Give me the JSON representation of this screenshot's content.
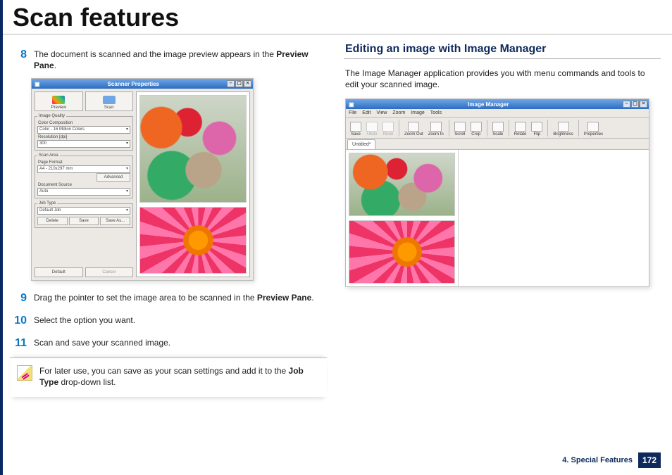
{
  "page_title": "Scan features",
  "steps": {
    "s8_num": "8",
    "s8_a": "The document is scanned and the image preview appears in the ",
    "s8_b": "Preview Pane",
    "s8_c": ".",
    "s9_num": "9",
    "s9_a": "Drag the pointer to set the image area to be scanned in the ",
    "s9_b": "Preview Pane",
    "s9_c": ".",
    "s10_num": "10",
    "s10": "Select the option you want.",
    "s11_num": "11",
    "s11": "Scan and save your scanned image."
  },
  "note_a": "For later use, you can save as your scan settings and add it to the ",
  "note_b": "Job Type",
  "note_c": " drop-down list.",
  "scanner": {
    "title": "Scanner Properties",
    "preview": "Preview",
    "scan": "Scan",
    "grp_quality": "Image Quality",
    "color_label": "Color Composition",
    "color_value": "Color - 16 Million Colors",
    "res_label": "Resolution [dpi]",
    "res_value": "300",
    "grp_area": "Scan Area",
    "page_label": "Page Format",
    "page_value": "A4 - 210x297 mm",
    "advanced": "Advanced",
    "docsrc_label": "Document Source",
    "docsrc_value": "Auto",
    "grp_job": "Job Type",
    "job_value": "Default Job",
    "delete": "Delete",
    "save": "Save",
    "saveas": "Save As...",
    "default": "Default",
    "cancel": "Cancel"
  },
  "right": {
    "heading": "Editing an image with Image Manager",
    "body": "The Image Manager application provides you with menu commands and tools to edit your scanned image."
  },
  "im": {
    "title": "Image Manager",
    "menu": {
      "file": "File",
      "edit": "Edit",
      "view": "View",
      "zoom": "Zoom",
      "image": "Image",
      "tools": "Tools"
    },
    "tb": {
      "save": "Save",
      "undo": "Undo",
      "redo": "Redo",
      "zoomout": "Zoom Out",
      "zoomin": "Zoom In",
      "scroll": "Scroll",
      "crop": "Crop",
      "scale": "Scale",
      "rotate": "Rotate",
      "flip": "Flip",
      "effect": "Brightness",
      "props": "Properties"
    },
    "tab": "Untitled*"
  },
  "footer": {
    "chapter": "4.  Special Features",
    "page": "172"
  }
}
